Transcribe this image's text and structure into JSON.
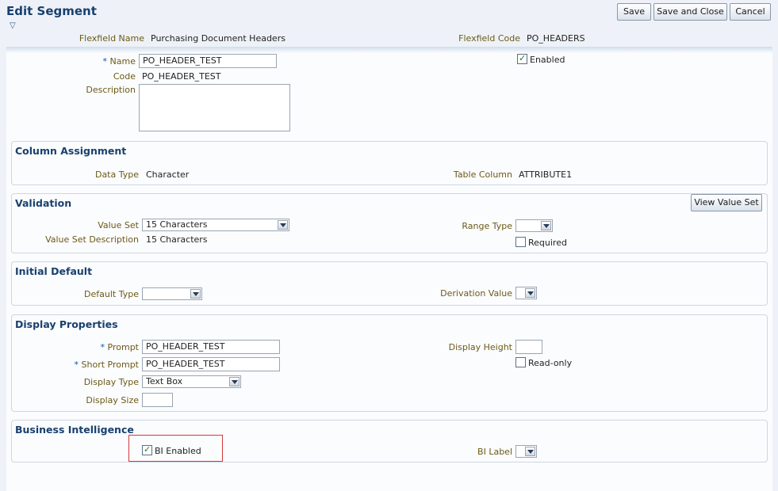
{
  "header": {
    "title": "Edit Segment",
    "save_label": "Save",
    "save_close_label": "Save and Close",
    "cancel_label": "Cancel",
    "disclose_glyph": "▽"
  },
  "flexfield": {
    "name_label": "Flexfield Name",
    "name_value": "Purchasing Document Headers",
    "code_label": "Flexfield Code",
    "code_value": "PO_HEADERS"
  },
  "segment": {
    "required_mark": "*",
    "name_label": "Name",
    "name_value": "PO_HEADER_TEST",
    "code_label": "Code",
    "code_value": "PO_HEADER_TEST",
    "description_label": "Description",
    "description_value": "",
    "enabled_label": "Enabled",
    "enabled_checked": true
  },
  "column_assignment": {
    "title": "Column Assignment",
    "data_type_label": "Data Type",
    "data_type_value": "Character",
    "table_column_label": "Table Column",
    "table_column_value": "ATTRIBUTE1"
  },
  "validation": {
    "title": "Validation",
    "view_value_set_label": "View Value Set",
    "value_set_label": "Value Set",
    "value_set_value": "15 Characters",
    "value_set_desc_label": "Value Set Description",
    "value_set_desc_value": "15 Characters",
    "range_type_label": "Range Type",
    "range_type_value": "",
    "required_label": "Required",
    "required_checked": false
  },
  "initial_default": {
    "title": "Initial Default",
    "default_type_label": "Default Type",
    "default_type_value": "",
    "derivation_value_label": "Derivation Value",
    "derivation_value_value": ""
  },
  "display_properties": {
    "title": "Display Properties",
    "prompt_label": "Prompt",
    "prompt_value": "PO_HEADER_TEST",
    "short_prompt_label": "Short Prompt",
    "short_prompt_value": "PO_HEADER_TEST",
    "display_type_label": "Display Type",
    "display_type_value": "Text Box",
    "display_size_label": "Display Size",
    "display_size_value": "",
    "display_height_label": "Display Height",
    "display_height_value": "",
    "read_only_label": "Read-only",
    "read_only_checked": false
  },
  "business_intelligence": {
    "title": "Business Intelligence",
    "bi_enabled_label": "BI Enabled",
    "bi_enabled_checked": true,
    "bi_label_label": "BI Label",
    "bi_label_value": ""
  }
}
